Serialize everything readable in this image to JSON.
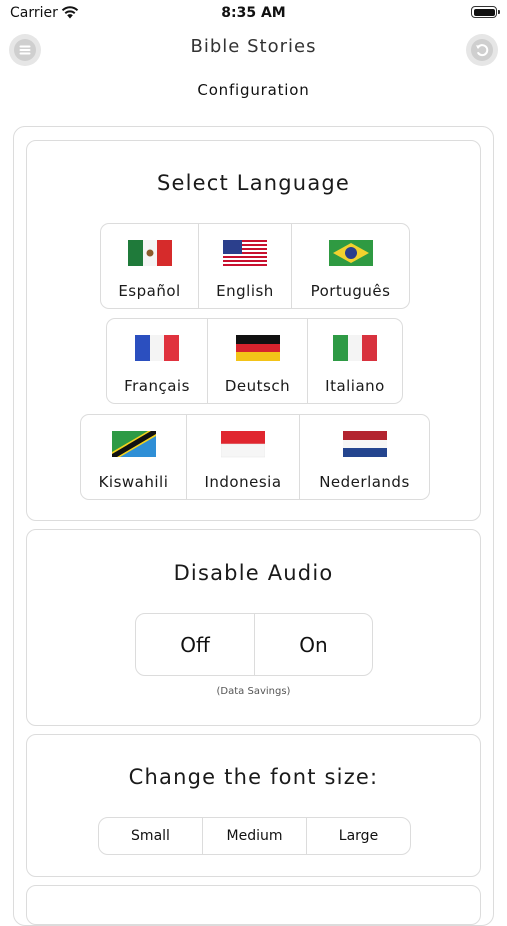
{
  "status_bar": {
    "carrier": "Carrier",
    "time": "8:35 AM"
  },
  "header": {
    "title": "Bible Stories",
    "subtitle": "Configuration",
    "left_icon": "hamburger-menu-icon",
    "right_icon": "back-arrow-icon"
  },
  "language": {
    "heading": "Select Language",
    "rows": [
      [
        {
          "label": "Español",
          "flag": "mexico-flag-icon"
        },
        {
          "label": "English",
          "flag": "usa-flag-icon"
        },
        {
          "label": "Português",
          "flag": "brazil-flag-icon"
        }
      ],
      [
        {
          "label": "Français",
          "flag": "france-flag-icon"
        },
        {
          "label": "Deutsch",
          "flag": "germany-flag-icon"
        },
        {
          "label": "Italiano",
          "flag": "italy-flag-icon"
        }
      ],
      [
        {
          "label": "Kiswahili",
          "flag": "tanzania-flag-icon"
        },
        {
          "label": "Indonesia",
          "flag": "indonesia-flag-icon"
        },
        {
          "label": "Nederlands",
          "flag": "netherlands-flag-icon"
        }
      ]
    ]
  },
  "audio": {
    "heading": "Disable Audio",
    "options": [
      "Off",
      "On"
    ],
    "note": "(Data Savings)"
  },
  "font_size": {
    "heading": "Change the font size:",
    "options": [
      "Small",
      "Medium",
      "Large"
    ]
  }
}
